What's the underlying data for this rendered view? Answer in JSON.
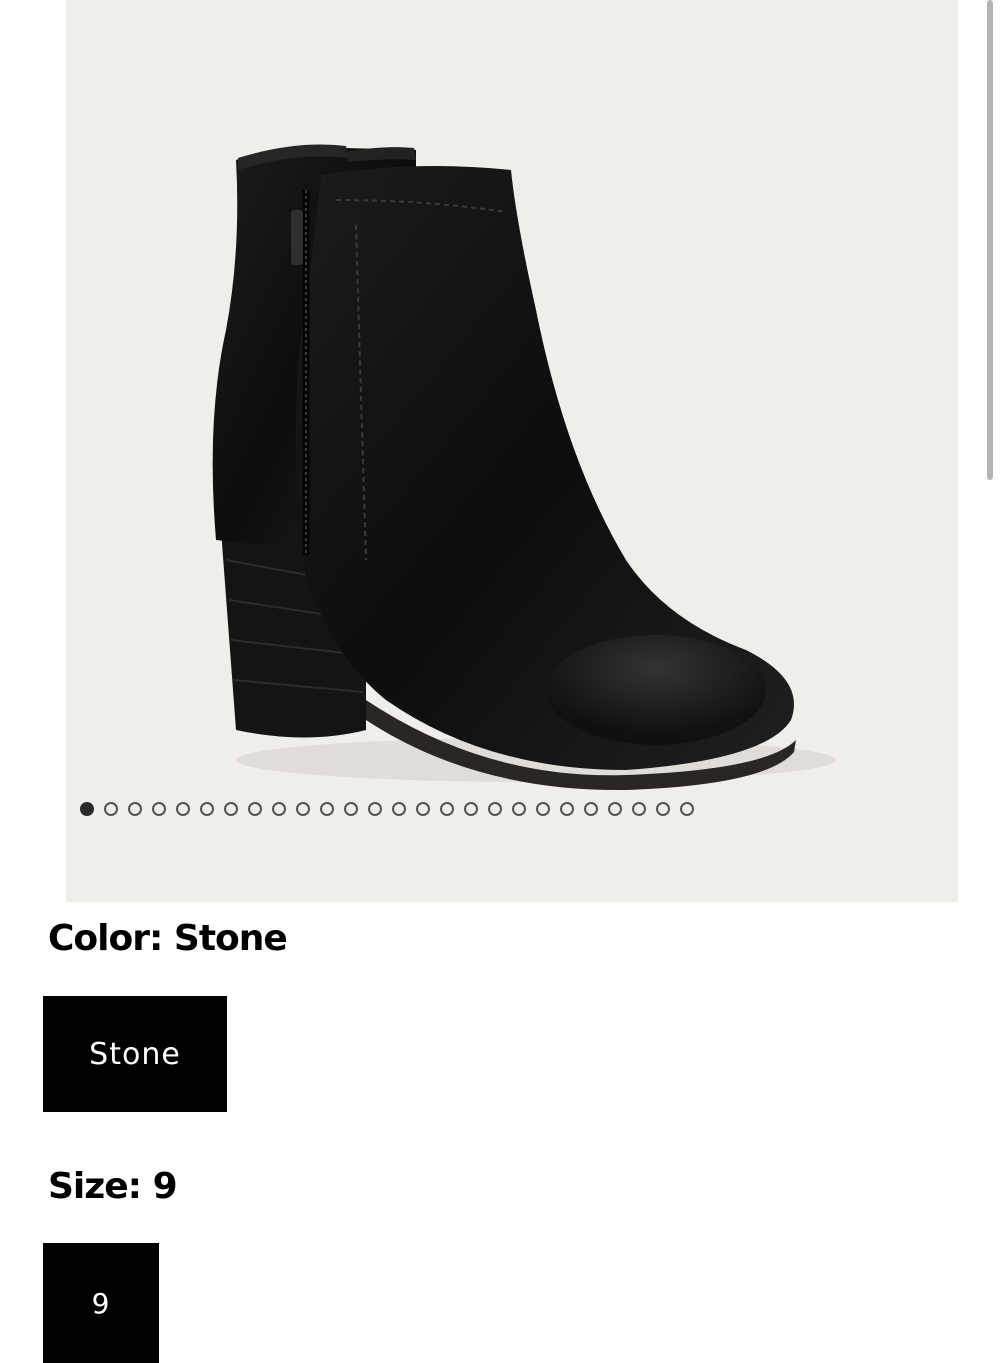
{
  "gallery": {
    "image_alt": "black leather ankle boot",
    "total_images": 26,
    "active_index": 0
  },
  "color": {
    "label": "Color: Stone",
    "option": "Stone"
  },
  "size": {
    "label": "Size: 9",
    "option": "9"
  },
  "colors": {
    "background": "#f0eeea",
    "swatch": "#000000",
    "swatch_text": "#ffffff"
  }
}
